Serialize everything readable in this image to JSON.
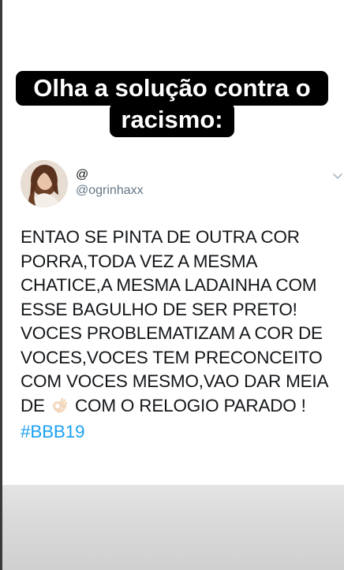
{
  "caption": {
    "line1": "Olha a solução contra o",
    "line2": "racismo:"
  },
  "tweet": {
    "display_name": "@",
    "handle": "@ogrinhaxx",
    "text_lines": [
      "ENTAO SE PINTA DE OUTRA COR",
      "PORRA,TODA VEZ A MESMA",
      "CHATICE,A MESMA LADAINHA COM",
      "ESSE BAGULHO DE SER PRETO!",
      "VOCES PROBLEMATIZAM A COR DE",
      "VOCES,VOCES TEM PRECONCEITO",
      "COM VOCES MESMO,VAO DAR MEIA"
    ],
    "last_line_prefix": "DE",
    "emoji_icon": "ok-hand-emoji-icon",
    "last_line_suffix": "COM O RELOGIO PARADO !",
    "hashtag": "#BBB19",
    "hashtag_color": "#1da1f2"
  },
  "colors": {
    "caption_bg": "#000000",
    "caption_text": "#ffffff",
    "handle": "#657786",
    "text": "#14171a"
  }
}
